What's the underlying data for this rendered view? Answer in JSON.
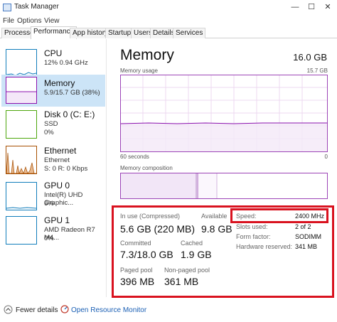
{
  "window": {
    "title": "Task Manager",
    "controls": [
      "—",
      "☐",
      "✕"
    ]
  },
  "menu": [
    "File",
    "Options",
    "View"
  ],
  "tabs": [
    {
      "label": "Processes",
      "active": false
    },
    {
      "label": "Performance",
      "active": true
    },
    {
      "label": "App history",
      "active": false
    },
    {
      "label": "Startup",
      "active": false
    },
    {
      "label": "Users",
      "active": false
    },
    {
      "label": "Details",
      "active": false
    },
    {
      "label": "Services",
      "active": false
    }
  ],
  "sidebar": {
    "items": [
      {
        "name": "CPU",
        "sub1": "12%  0.94 GHz",
        "sub2": "",
        "selected": false,
        "color": "#117dbb"
      },
      {
        "name": "Memory",
        "sub1": "5.9/15.7 GB (38%)",
        "sub2": "",
        "selected": true,
        "color": "#8b12ae"
      },
      {
        "name": "Disk 0 (C: E:)",
        "sub1": "SSD",
        "sub2": "0%",
        "selected": false,
        "color": "#4da60c"
      },
      {
        "name": "Ethernet",
        "sub1": "Ethernet",
        "sub2": "S: 0  R: 0 Kbps",
        "selected": false,
        "color": "#a74f01"
      },
      {
        "name": "GPU 0",
        "sub1": "Intel(R) UHD Graphic...",
        "sub2": "6%",
        "selected": false,
        "color": "#117dbb"
      },
      {
        "name": "GPU 1",
        "sub1": "AMD Radeon R7 M4...",
        "sub2": "0%",
        "selected": false,
        "color": "#117dbb"
      }
    ]
  },
  "main": {
    "title": "Memory",
    "total": "16.0 GB",
    "usage_label": "Memory usage",
    "usage_max": "15.7 GB",
    "time_label": "60 seconds",
    "time_end": "0",
    "composition_label": "Memory composition",
    "stats": {
      "in_use_label": "In use (Compressed)",
      "in_use_value": "5.6 GB (220 MB)",
      "available_label": "Available",
      "available_value": "9.8 GB",
      "committed_label": "Committed",
      "committed_value": "7.3/18.0 GB",
      "cached_label": "Cached",
      "cached_value": "1.9 GB",
      "paged_label": "Paged pool",
      "paged_value": "396 MB",
      "nonpaged_label": "Non-paged pool",
      "nonpaged_value": "361 MB"
    },
    "details": {
      "speed_label": "Speed:",
      "speed_value": "2400 MHz",
      "slots_label": "Slots used:",
      "slots_value": "2 of 2",
      "form_label": "Form factor:",
      "form_value": "SODIMM",
      "reserved_label": "Hardware reserved:",
      "reserved_value": "341 MB"
    }
  },
  "footer": {
    "fewer_details": "Fewer details",
    "resource_monitor": "Open Resource Monitor"
  },
  "colors": {
    "memory": "#8b12ae",
    "highlight": "#d9121f",
    "selected_bg": "#cce4f7"
  }
}
